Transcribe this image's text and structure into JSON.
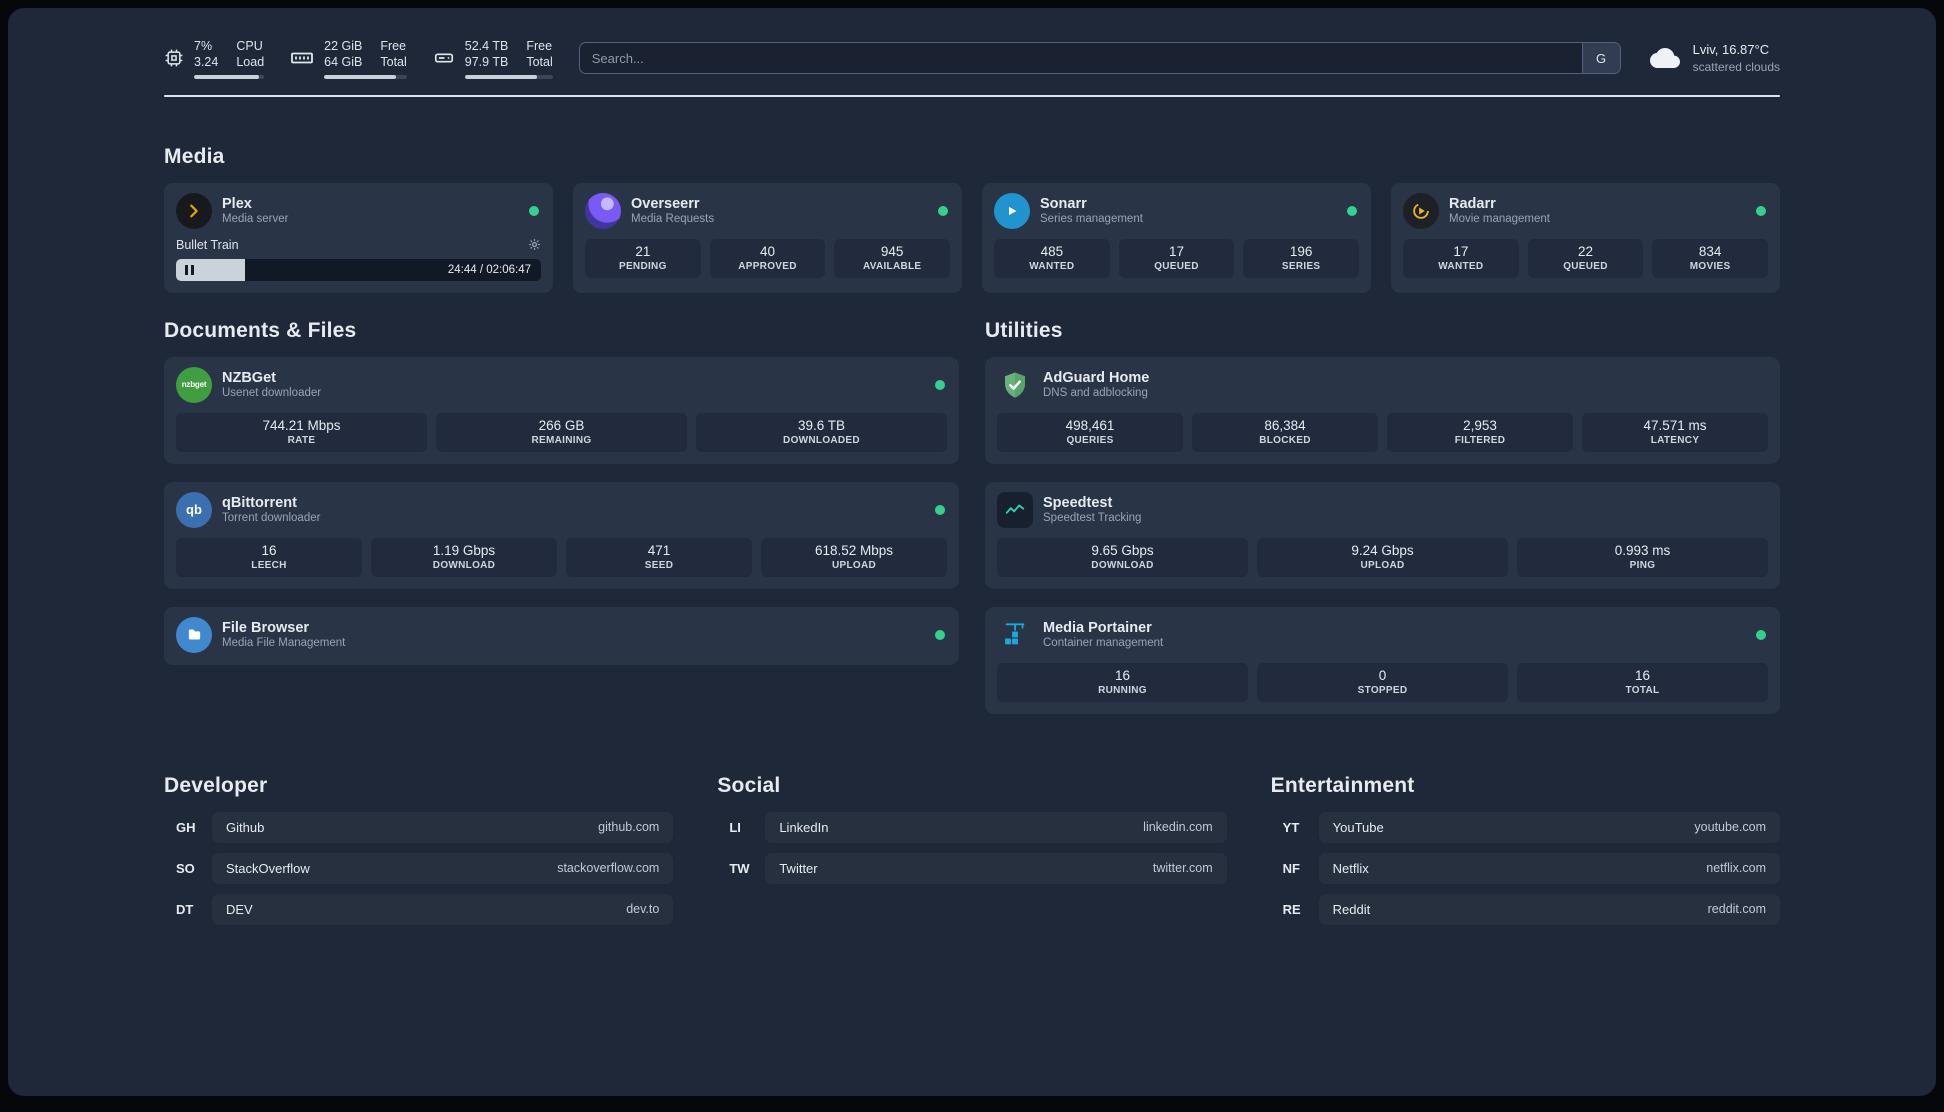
{
  "theme": {
    "page_bg": "#1f2838",
    "card_bg": "#2a3447",
    "tile_bg": "#212b3d",
    "accent_green": "#35d08e",
    "text_primary": "#e7ebf1",
    "text_muted": "#9aa4b6"
  },
  "topbar": {
    "cpu": {
      "icon": "cpu-icon",
      "values": [
        "7%",
        "3.24"
      ],
      "labels": [
        "CPU",
        "Load"
      ],
      "progress": 92
    },
    "ram": {
      "icon": "ram-icon",
      "values": [
        "22 GiB",
        "64 GiB"
      ],
      "labels": [
        "Free",
        "Total"
      ],
      "progress": 87
    },
    "disk": {
      "icon": "disk-icon",
      "values": [
        "52.4 TB",
        "97.9 TB"
      ],
      "labels": [
        "Free",
        "Total"
      ],
      "progress": 82
    },
    "search": {
      "placeholder": "Search...",
      "button_label": "G"
    },
    "weather": {
      "icon": "cloud-icon",
      "location": "Lviv, 16.87°C",
      "condition": "scattered clouds"
    }
  },
  "sections": {
    "media": {
      "title": "Media",
      "plex": {
        "name": "Plex",
        "subtitle": "Media server",
        "status": "online",
        "icon": "plex-icon",
        "player": {
          "track": "Bullet Train",
          "time": "24:44 / 02:06:47",
          "progress": 19
        }
      },
      "overseerr": {
        "name": "Overseerr",
        "subtitle": "Media Requests",
        "status": "online",
        "icon": "overseerr-icon",
        "stats": [
          {
            "value": "21",
            "label": "PENDING"
          },
          {
            "value": "40",
            "label": "APPROVED"
          },
          {
            "value": "945",
            "label": "AVAILABLE"
          }
        ]
      },
      "sonarr": {
        "name": "Sonarr",
        "subtitle": "Series management",
        "status": "online",
        "icon": "sonarr-icon",
        "stats": [
          {
            "value": "485",
            "label": "WANTED"
          },
          {
            "value": "17",
            "label": "QUEUED"
          },
          {
            "value": "196",
            "label": "SERIES"
          }
        ]
      },
      "radarr": {
        "name": "Radarr",
        "subtitle": "Movie management",
        "status": "online",
        "icon": "radarr-icon",
        "stats": [
          {
            "value": "17",
            "label": "WANTED"
          },
          {
            "value": "22",
            "label": "QUEUED"
          },
          {
            "value": "834",
            "label": "MOVIES"
          }
        ]
      }
    },
    "documents": {
      "title": "Documents & Files",
      "nzbget": {
        "name": "NZBGet",
        "subtitle": "Usenet downloader",
        "status": "online",
        "icon": "nzbget-icon",
        "icon_text": "nzbget",
        "stats": [
          {
            "value": "744.21 Mbps",
            "label": "RATE"
          },
          {
            "value": "266 GB",
            "label": "REMAINING"
          },
          {
            "value": "39.6 TB",
            "label": "DOWNLOADED"
          }
        ]
      },
      "qbittorrent": {
        "name": "qBittorrent",
        "subtitle": "Torrent downloader",
        "status": "online",
        "icon": "qbittorrent-icon",
        "icon_text": "qb",
        "stats": [
          {
            "value": "16",
            "label": "LEECH"
          },
          {
            "value": "1.19 Gbps",
            "label": "DOWNLOAD"
          },
          {
            "value": "471",
            "label": "SEED"
          },
          {
            "value": "618.52 Mbps",
            "label": "UPLOAD"
          }
        ]
      },
      "filebrowser": {
        "name": "File Browser",
        "subtitle": "Media File Management",
        "status": "online",
        "icon": "filebrowser-icon"
      }
    },
    "utilities": {
      "title": "Utilities",
      "adguard": {
        "name": "AdGuard Home",
        "subtitle": "DNS and adblocking",
        "icon": "adguard-icon",
        "stats": [
          {
            "value": "498,461",
            "label": "QUERIES"
          },
          {
            "value": "86,384",
            "label": "BLOCKED"
          },
          {
            "value": "2,953",
            "label": "FILTERED"
          },
          {
            "value": "47.571 ms",
            "label": "LATENCY"
          }
        ]
      },
      "speedtest": {
        "name": "Speedtest",
        "subtitle": "Speedtest Tracking",
        "icon": "speedtest-icon",
        "stats": [
          {
            "value": "9.65 Gbps",
            "label": "DOWNLOAD"
          },
          {
            "value": "9.24 Gbps",
            "label": "UPLOAD"
          },
          {
            "value": "0.993 ms",
            "label": "PING"
          }
        ]
      },
      "portainer": {
        "name": "Media Portainer",
        "subtitle": "Container management",
        "status": "online",
        "icon": "portainer-icon",
        "stats": [
          {
            "value": "16",
            "label": "RUNNING"
          },
          {
            "value": "0",
            "label": "STOPPED"
          },
          {
            "value": "16",
            "label": "TOTAL"
          }
        ]
      }
    },
    "bookmarks": {
      "developer": {
        "title": "Developer",
        "items": [
          {
            "abbr": "GH",
            "name": "Github",
            "url": "github.com"
          },
          {
            "abbr": "SO",
            "name": "StackOverflow",
            "url": "stackoverflow.com"
          },
          {
            "abbr": "DT",
            "name": "DEV",
            "url": "dev.to"
          }
        ]
      },
      "social": {
        "title": "Social",
        "items": [
          {
            "abbr": "LI",
            "name": "LinkedIn",
            "url": "linkedin.com"
          },
          {
            "abbr": "TW",
            "name": "Twitter",
            "url": "twitter.com"
          }
        ]
      },
      "entertainment": {
        "title": "Entertainment",
        "items": [
          {
            "abbr": "YT",
            "name": "YouTube",
            "url": "youtube.com"
          },
          {
            "abbr": "NF",
            "name": "Netflix",
            "url": "netflix.com"
          },
          {
            "abbr": "RE",
            "name": "Reddit",
            "url": "reddit.com"
          }
        ]
      }
    }
  }
}
